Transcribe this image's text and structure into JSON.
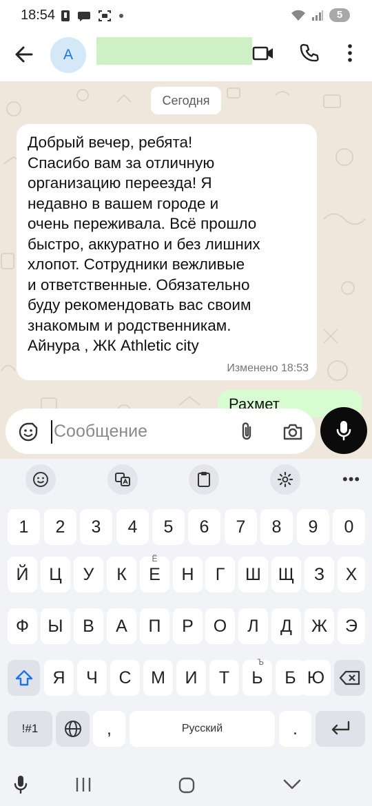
{
  "status_bar": {
    "time": "18:54",
    "battery": "5"
  },
  "header": {
    "avatar_letter": "А",
    "contact_name": ""
  },
  "chat": {
    "date_chip": "Сегодня",
    "incoming_message": {
      "text": "Добрый вечер, ребята!\nСпасибо вам за отличную\nорганизацию переезда! Я\nнедавно  в вашем городе и\nочень переживала. Всё прошло\nбыстро, аккуратно и без лишних\nхлопот. Сотрудники вежливые\nи ответственные. Обязательно\nбуду рекомендовать вас своим\nзнакомым и родственникам.\nАйнура , ЖК Athletic city",
      "meta": "Изменено 18:53"
    },
    "outgoing_message": {
      "text": "Рахмет"
    }
  },
  "composer": {
    "placeholder": "Сообщение"
  },
  "keyboard": {
    "numbers": [
      "1",
      "2",
      "3",
      "4",
      "5",
      "6",
      "7",
      "8",
      "9",
      "0"
    ],
    "row1": [
      "Й",
      "Ц",
      "У",
      "К",
      "Е",
      "Н",
      "Г",
      "Ш",
      "Щ",
      "З",
      "Х"
    ],
    "row1_hint_e": "Ё",
    "row2": [
      "Ф",
      "Ы",
      "В",
      "А",
      "П",
      "Р",
      "О",
      "Л",
      "Д",
      "Ж",
      "Э"
    ],
    "row3": [
      "Я",
      "Ч",
      "С",
      "М",
      "И",
      "Т",
      "Ь",
      "Б",
      "Ю"
    ],
    "row3_hint_soft": "Ъ",
    "symbols_key": "!#1",
    "comma_key": ",",
    "space_label": "Русский",
    "period_key": "."
  },
  "colors": {
    "chat_background": "#efe7dc",
    "outgoing_bubble": "#d9fdd3",
    "mic_button": "#0b0b0b",
    "avatar_bg": "#d4e8f7",
    "shift_active": "#1a73e8"
  }
}
